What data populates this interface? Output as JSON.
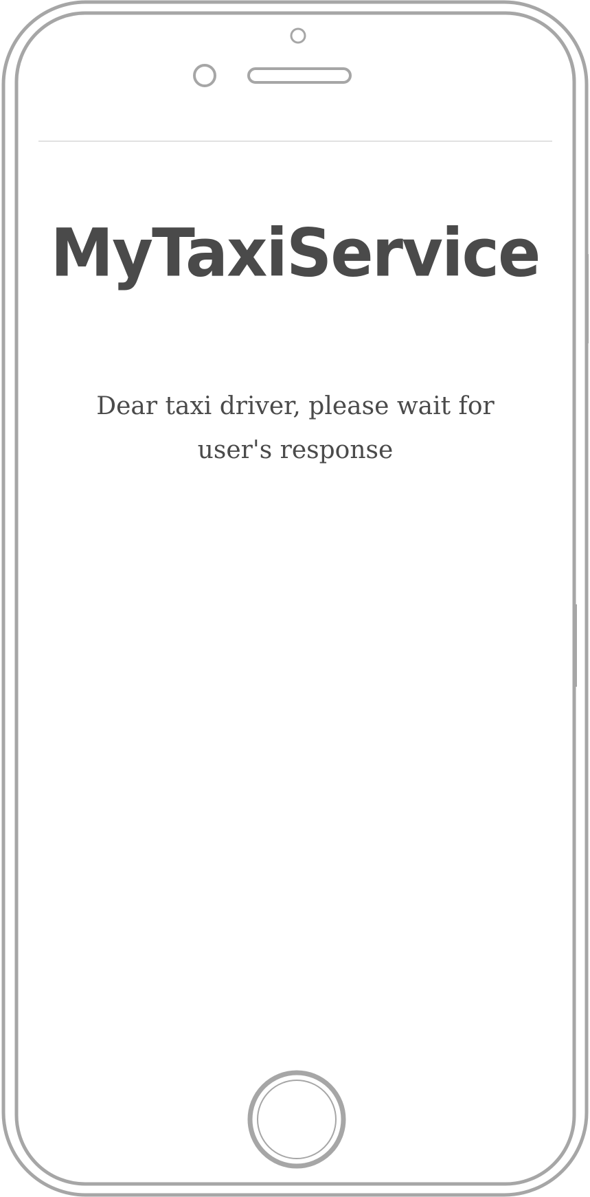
{
  "app": {
    "title": "MyTaxiService"
  },
  "waiting_screen": {
    "message": "Dear taxi driver, please wait for user's response"
  },
  "colors": {
    "frame_stroke": "#a6a6a6",
    "text": "#4a4a4a",
    "divider": "#c8c8c8",
    "background": "#ffffff"
  },
  "icons": {
    "front_camera": "front-camera-icon",
    "sensor": "sensor-icon",
    "speaker": "speaker-grille-icon",
    "home_button": "home-button-icon"
  }
}
